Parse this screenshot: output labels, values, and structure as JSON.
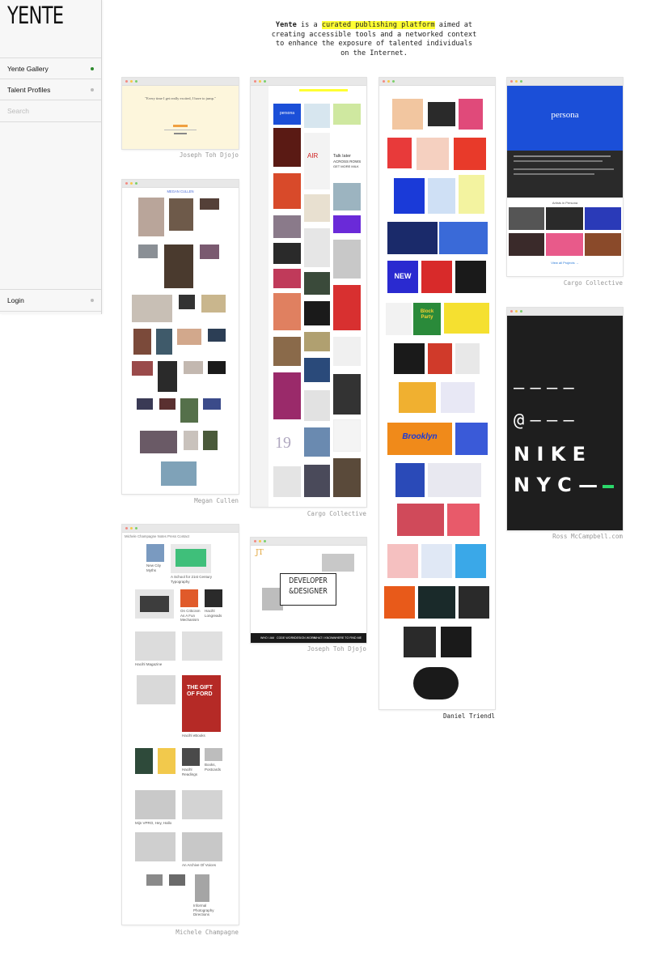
{
  "sidebar": {
    "logo": "YENTE",
    "nav": [
      {
        "label": "Yente Gallery",
        "active": true
      },
      {
        "label": "Talent Profiles",
        "active": false
      }
    ],
    "search_placeholder": "Search",
    "login_label": "Login"
  },
  "intro": {
    "brand": "Yente",
    "pre": " is a ",
    "highlight": "curated publishing platform",
    "post": " aimed at creating accessible tools and a networked context to enhance the exposure of talented individuals on the Internet."
  },
  "cards": [
    {
      "id": "joseph1",
      "caption": "Joseph Toh Djojo",
      "quote": "\"Every time I get really excited, I have to jump.\""
    },
    {
      "id": "megan",
      "caption": "Megan Cullen",
      "site_title": "MEGAN CULLEN"
    },
    {
      "id": "michele",
      "caption": "Michele Champagne",
      "nav": "Michele Champagne   Notes   Press   Contact",
      "items": [
        "New City Myths",
        "A School for 21st Century Typography",
        "On Criticism As A Fun Mechanism",
        "Hacihl Longreads",
        "Hacihl Magazine",
        "THE GIFT OF FORD",
        "Hacihl eBooks",
        "Hacihl Readings",
        "Books, Postcards",
        "Mijn VPRO, Hey, Hallo",
        "An Archive Of Voices",
        "Informal Photography Directions"
      ]
    },
    {
      "id": "cargo1",
      "caption": "Cargo Collective",
      "thumb_texts": [
        "persona",
        "Talk later",
        "ACROSS ROWS",
        "GET MORE MILK",
        "AIR",
        "19"
      ]
    },
    {
      "id": "joseph2",
      "caption": "Joseph Toh Djojo",
      "monogram": "JT",
      "headline_1": "DEVELOPER",
      "headline_2": "&DESIGNER",
      "menu": [
        "WHO I AM",
        "CODE WORK",
        "DESIGN WORK",
        "WHAT I KNOW",
        "WHERE TO FIND ME"
      ]
    },
    {
      "id": "daniel",
      "caption": "Daniel Triendl",
      "thumb_texts": [
        "NEW",
        "Block Party",
        "Brooklyn"
      ]
    },
    {
      "id": "cargo2",
      "caption": "Cargo Collective",
      "title": "persona",
      "sub": "Artists in Persona",
      "link": "View all Projects →"
    },
    {
      "id": "ross",
      "caption": "Ross McCampbell.com",
      "rows": [
        "— — — —",
        "@ — — —",
        "N I K E",
        "N Y C —"
      ]
    }
  ],
  "colors": {
    "highlight": "#ffff33",
    "active_dot": "#2d8a2d",
    "nike_green": "#2bd86a",
    "persona_blue": "#1b4fd8"
  }
}
